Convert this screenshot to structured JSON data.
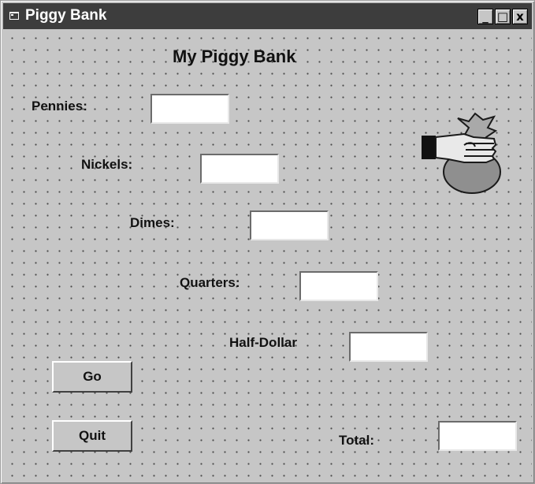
{
  "window": {
    "title": "Piggy Bank",
    "minimize_label": "_",
    "maximize_label": "□",
    "close_label": "x"
  },
  "form": {
    "heading": "My Piggy Bank",
    "fields": {
      "pennies": {
        "label": "Pennies:",
        "value": ""
      },
      "nickels": {
        "label": "Nickels:",
        "value": ""
      },
      "dimes": {
        "label": "Dimes:",
        "value": ""
      },
      "quarters": {
        "label": "Quarters:",
        "value": ""
      },
      "half_dollar": {
        "label": "Half-Dollar",
        "value": ""
      },
      "total": {
        "label": "Total:",
        "value": ""
      }
    },
    "buttons": {
      "go_label": "Go",
      "quit_label": "Quit"
    },
    "image_icon": "hand-with-money-bag-icon"
  }
}
